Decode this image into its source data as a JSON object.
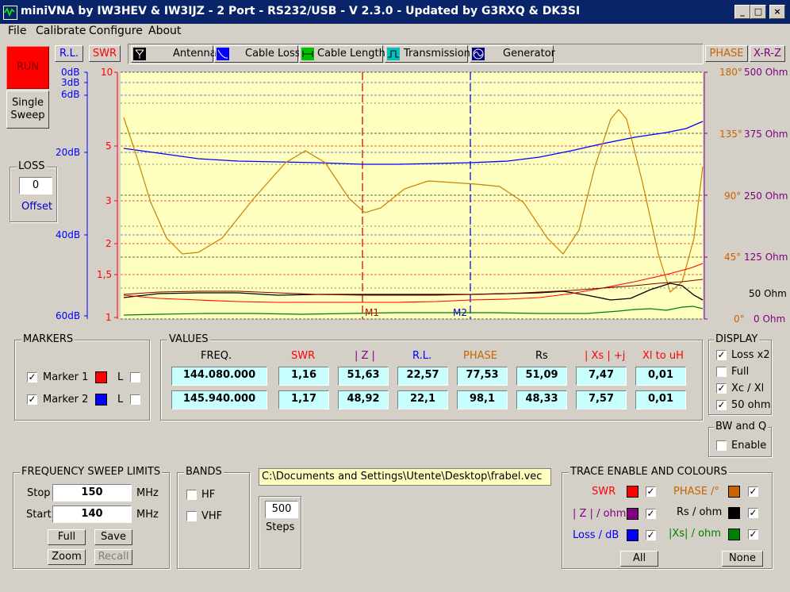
{
  "window": {
    "title": "miniVNA by IW3HEV & IW3IJZ - 2 Port - RS232/USB - V 2.3.0 - Updated by G3RXQ & DK3SI"
  },
  "menu": {
    "file": "File",
    "calibrate": "Calibrate",
    "configure": "Configure",
    "about": "About"
  },
  "controls": {
    "run": "RUN",
    "single_sweep_line1": "Single",
    "single_sweep_line2": "Sweep"
  },
  "loss": {
    "title": "LOSS",
    "value": "0",
    "offset_label": "Offset"
  },
  "modes": {
    "rl": "R.L.",
    "swr": "SWR",
    "phase": "PHASE",
    "xrz": "X-R-Z"
  },
  "tabs": [
    "Antenna",
    "Cable Loss",
    "Cable Length",
    "Transmission",
    "Generator"
  ],
  "left_axis": {
    "rl": [
      "0dB",
      "3dB",
      "6dB",
      "20dB",
      "40dB",
      "60dB"
    ],
    "swr": [
      "10",
      "5",
      "3",
      "2",
      "1,5",
      "1"
    ]
  },
  "right_axis": {
    "phase": [
      "180°",
      "135°",
      "90°",
      "45°",
      "0°"
    ],
    "ohm": [
      "500 Ohm",
      "375 Ohm",
      "250 Ohm",
      "125 Ohm",
      "50 Ohm",
      "0 Ohm"
    ]
  },
  "plot_markers": {
    "m1": "M1",
    "m2": "M2"
  },
  "markers": {
    "title": "MARKERS",
    "marker1": {
      "label": "Marker 1",
      "checked": true,
      "color": "#ff0000",
      "l": "L"
    },
    "marker2": {
      "label": "Marker 2",
      "checked": true,
      "color": "#0000ff",
      "l": "L"
    }
  },
  "values": {
    "title": "VALUES",
    "headers": [
      "FREQ.",
      "SWR",
      "| Z |",
      "R.L.",
      "PHASE",
      "Rs",
      "| Xs | +j",
      "Xl to uH"
    ],
    "rows": [
      [
        "144.080.000",
        "1,16",
        "51,63",
        "22,57",
        "77,53",
        "51,09",
        "7,47",
        "0,01"
      ],
      [
        "145.940.000",
        "1,17",
        "48,92",
        "22,1",
        "98,1",
        "48,33",
        "7,57",
        "0,01"
      ]
    ]
  },
  "display": {
    "title": "DISPLAY",
    "items": [
      {
        "label": "Loss x2",
        "checked": true
      },
      {
        "label": "Full",
        "checked": false
      },
      {
        "label": "Xc / Xl",
        "checked": true
      },
      {
        "label": "50 ohm",
        "checked": true
      }
    ]
  },
  "bwq": {
    "title": "BW and Q",
    "enable": "Enable",
    "checked": false
  },
  "sweep": {
    "title": "FREQUENCY SWEEP LIMITS",
    "stop_label": "Stop",
    "stop_value": "150",
    "start_label": "Start",
    "start_value": "140",
    "unit": "MHz",
    "full": "Full",
    "save": "Save",
    "zoom": "Zoom",
    "recall": "Recall"
  },
  "bands": {
    "title": "BANDS",
    "hf": "HF",
    "vhf": "VHF"
  },
  "file_path": "C:\\Documents and Settings\\Utente\\Desktop\\frabel.vec",
  "steps": {
    "value": "500",
    "label": "Steps"
  },
  "trace": {
    "title": "TRACE ENABLE AND COLOURS",
    "swr": {
      "label": "SWR",
      "color": "#ff0000"
    },
    "z": {
      "label": "| Z | / ohm",
      "color": "#800080"
    },
    "loss": {
      "label": "Loss / dB",
      "color": "#0000ff"
    },
    "phase": {
      "label": "PHASE /°",
      "color": "#c86400"
    },
    "rs": {
      "label": "Rs / ohm",
      "color": "#000000"
    },
    "xs": {
      "label": "|Xs| / ohm",
      "color": "#008000"
    },
    "all": "All",
    "none": "None"
  }
}
